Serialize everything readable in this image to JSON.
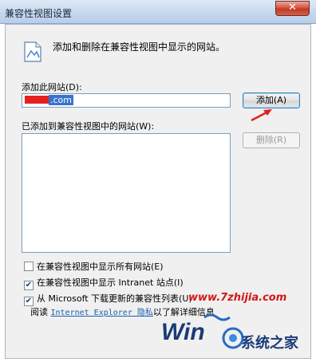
{
  "window": {
    "title": "兼容性视图设置",
    "close_label": "✕"
  },
  "intro": {
    "text": "添加和删除在兼容性视图中显示的网站。",
    "icon": "document-image-icon"
  },
  "add_section": {
    "label": "添加此网站(D):",
    "input_value": ".com",
    "add_button": "添加(A)"
  },
  "list_section": {
    "label": "已添加到兼容性视图中的网站(W):",
    "remove_button": "删除(R)",
    "items": []
  },
  "options": [
    {
      "label": "在兼容性视图中显示所有网站(E)",
      "checked": false
    },
    {
      "label": "在兼容性视图中显示 Intranet 站点(I)",
      "checked": true
    },
    {
      "label": "从 Microsoft 下载更新的兼容性列表(U)",
      "checked": true
    }
  ],
  "read": {
    "prefix": "阅读",
    "link": "Internet Explorer 隐私",
    "suffix": "以了解详细信息"
  },
  "watermark": {
    "url": "www.7zhijia.com",
    "brand": "系统之家",
    "logo_letters": "Win"
  },
  "colors": {
    "accent": "#3c7fb1",
    "close": "#c13a24",
    "watermark": "#d21818"
  }
}
